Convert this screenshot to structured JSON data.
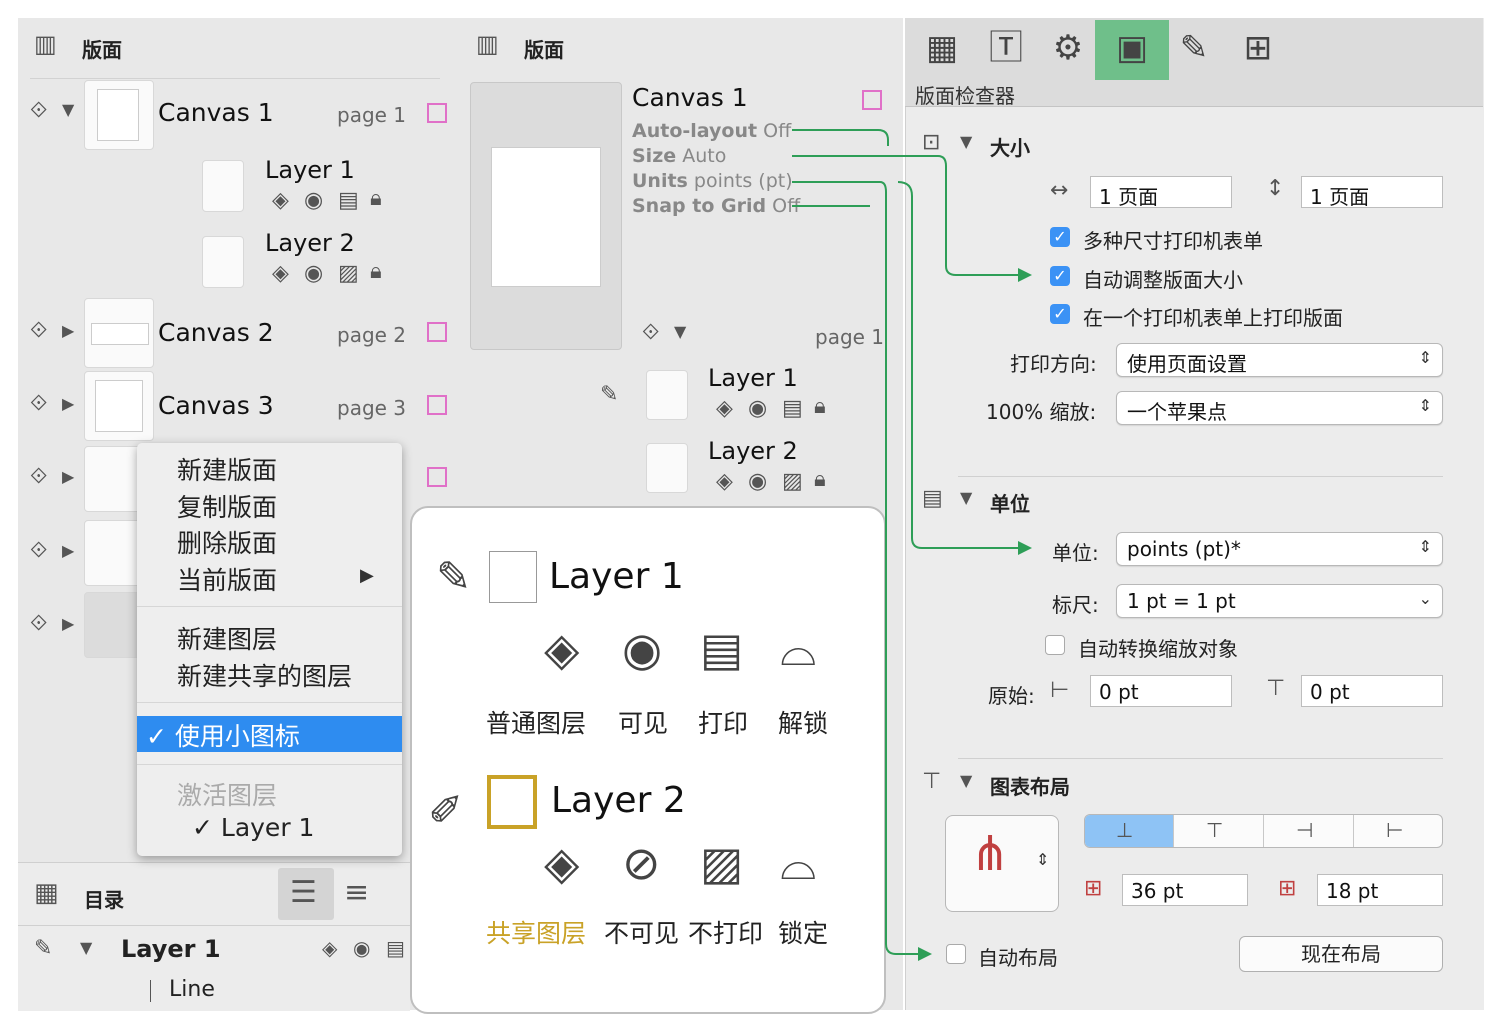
{
  "left_panel": {
    "header": "版面",
    "canvases": [
      {
        "name": "Canvas 1",
        "page": "page 1"
      },
      {
        "name": "Canvas 2",
        "page": "page 2"
      },
      {
        "name": "Canvas 3",
        "page": "page 3"
      }
    ],
    "layers": [
      "Layer 1",
      "Layer 2"
    ],
    "outline": {
      "header": "目录",
      "layer": "Layer 1",
      "item": "Line"
    }
  },
  "context_menu": {
    "items": [
      "新建版面",
      "复制版面",
      "删除版面",
      "当前版面"
    ],
    "layer_items": [
      "新建图层",
      "新建共享的图层"
    ],
    "checked_item": "✓ 使用小图标",
    "disabled_item": "激活图层",
    "active_layer": "✓ Layer 1"
  },
  "mid_panel": {
    "header": "版面",
    "canvas_name": "Canvas 1",
    "properties": [
      {
        "key": "Auto-layout",
        "value": "Off"
      },
      {
        "key": "Size",
        "value": "Auto"
      },
      {
        "key": "Units",
        "value": "points (pt)"
      },
      {
        "key": "Snap to Grid",
        "value": "Off"
      }
    ],
    "page": "page 1",
    "layers": [
      "Layer 1",
      "Layer 2"
    ]
  },
  "callout": {
    "layer1": "Layer 1",
    "layer2": "Layer 2",
    "captions_top": [
      "普通图层",
      "可见",
      "打印",
      "解锁"
    ],
    "captions_bottom": [
      "共享图层",
      "不可见",
      "不打印",
      "锁定"
    ],
    "shared_color": "#c9a227"
  },
  "inspector": {
    "title": "版面检查器",
    "size_section": {
      "title": "大小",
      "width": "1 页面",
      "height": "1 页面",
      "check_multi_size": "多种尺寸打印机表单",
      "check_auto_resize": "自动调整版面大小",
      "check_one_sheet": "在一个打印机表单上打印版面",
      "orientation_label": "打印方向:",
      "orientation_value": "使用页面设置",
      "scale_label": "100% 缩放:",
      "scale_value": "一个苹果点"
    },
    "units_section": {
      "title": "单位",
      "units_label": "单位:",
      "units_value": "points (pt)*",
      "ruler_label": "标尺:",
      "ruler_value": "1 pt = 1 pt",
      "check_auto_convert": "自动转换缩放对象",
      "origin_label": "原始:",
      "origin_x": "0 pt",
      "origin_y": "0 pt"
    },
    "layout_section": {
      "title": "图表布局",
      "spacing_1": "36 pt",
      "spacing_2": "18 pt",
      "check_auto_layout": "自动布局",
      "layout_now_button": "现在布局"
    }
  },
  "colors": {
    "accent_blue": "#2e8cf0",
    "connector_green": "#2e9e57",
    "active_tab_green": "#6fbf8a"
  }
}
